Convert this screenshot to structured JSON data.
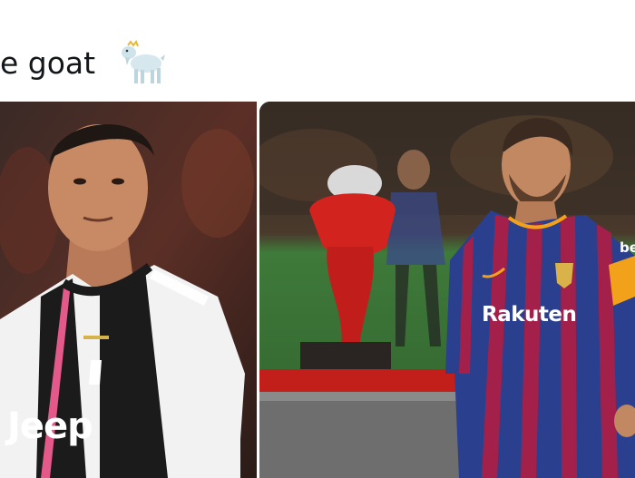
{
  "tweet": {
    "text": "e goat",
    "emoji_icon": "goat-icon"
  },
  "media": {
    "left_photo": {
      "subject": "player-in-black-white-striped-jersey",
      "jersey_text": "Jeep"
    },
    "right_photo": {
      "subject": "player-in-blue-red-striped-jersey-with-trophy",
      "jersey_text": "Rakuten",
      "sleeve_text": "be"
    }
  },
  "colors": {
    "background": "#ffffff",
    "text": "#14171a",
    "left_jersey_black": "#1b1b1b",
    "left_jersey_white": "#f2f2f2",
    "left_jersey_pink": "#e35a8a",
    "right_jersey_blue": "#2b3f8f",
    "right_jersey_red": "#a3204a",
    "pitch_green": "#3f7a3a",
    "trophy_red": "#d2231f"
  }
}
